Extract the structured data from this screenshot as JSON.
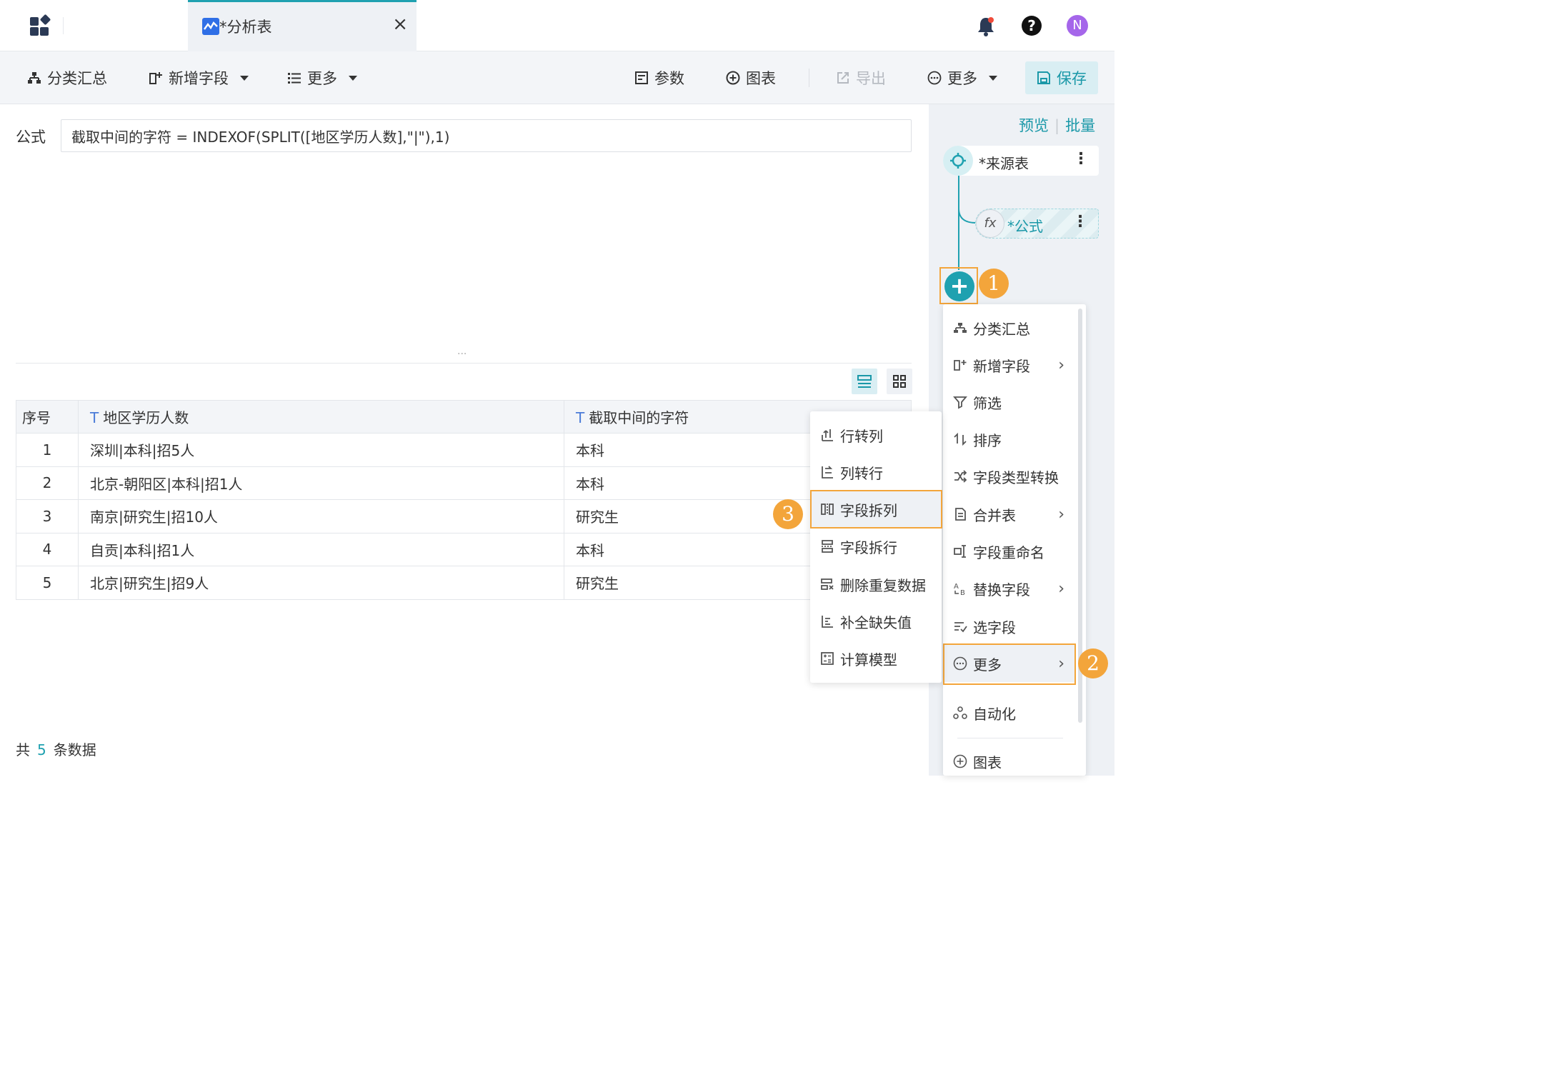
{
  "topbar": {
    "tab_title": "*分析表",
    "avatar_initial": "N"
  },
  "toolbar": {
    "group_summary": "分类汇总",
    "add_field": "新增字段",
    "more_left": "更多",
    "params": "参数",
    "chart": "图表",
    "export": "导出",
    "more_right": "更多",
    "save": "保存"
  },
  "formula": {
    "label": "公式",
    "value": "截取中间的字符 = INDEXOF(SPLIT([地区学历人数],\"|\"),1)"
  },
  "table": {
    "headers": [
      "序号",
      "地区学历人数",
      "截取中间的字符"
    ],
    "type_icon": "T",
    "rows": [
      [
        "1",
        "深圳|本科|招5人",
        "本科"
      ],
      [
        "2",
        "北京-朝阳区|本科|招1人",
        "本科"
      ],
      [
        "3",
        "南京|研究生|招10人",
        "研究生"
      ],
      [
        "4",
        "自贡|本科|招1人",
        "本科"
      ],
      [
        "5",
        "北京|研究生|招9人",
        "研究生"
      ]
    ]
  },
  "footer": {
    "prefix": "共",
    "count": "5",
    "suffix": "条数据"
  },
  "flow": {
    "preview": "预览",
    "batch": "批量",
    "source_node": "*来源表",
    "formula_node": "*公式",
    "formula_icon": "fx",
    "more_glyph": "⋮",
    "add_glyph": "+"
  },
  "badges": {
    "one": "1",
    "two": "2",
    "three": "3"
  },
  "menu_main": [
    {
      "label": "分类汇总",
      "icon": "group-summary-icon",
      "submenu": false
    },
    {
      "label": "新增字段",
      "icon": "add-field-icon",
      "submenu": true
    },
    {
      "label": "筛选",
      "icon": "filter-icon",
      "submenu": false
    },
    {
      "label": "排序",
      "icon": "sort-icon",
      "submenu": false
    },
    {
      "label": "字段类型转换",
      "icon": "type-convert-icon",
      "submenu": false
    },
    {
      "label": "合并表",
      "icon": "merge-table-icon",
      "submenu": true
    },
    {
      "label": "字段重命名",
      "icon": "rename-field-icon",
      "submenu": false
    },
    {
      "label": "替换字段",
      "icon": "replace-field-icon",
      "submenu": true
    },
    {
      "label": "选字段",
      "icon": "select-field-icon",
      "submenu": false
    },
    {
      "label": "更多",
      "icon": "more-circle-icon",
      "submenu": true
    },
    {
      "label": "自动化",
      "icon": "automation-icon",
      "submenu": false
    },
    {
      "label": "图表",
      "icon": "chart-plus-icon",
      "submenu": false
    }
  ],
  "menu_sub": [
    {
      "label": "行转列",
      "icon": "row-to-col-icon"
    },
    {
      "label": "列转行",
      "icon": "col-to-row-icon"
    },
    {
      "label": "字段拆列",
      "icon": "split-col-icon"
    },
    {
      "label": "字段拆行",
      "icon": "split-row-icon"
    },
    {
      "label": "删除重复数据",
      "icon": "dedupe-icon"
    },
    {
      "label": "补全缺失值",
      "icon": "fill-missing-icon"
    },
    {
      "label": "计算模型",
      "icon": "calc-model-icon"
    }
  ],
  "colors": {
    "accent": "#1fa1b0",
    "highlight_border": "#f3a53b",
    "avatar": "#a566ea"
  }
}
